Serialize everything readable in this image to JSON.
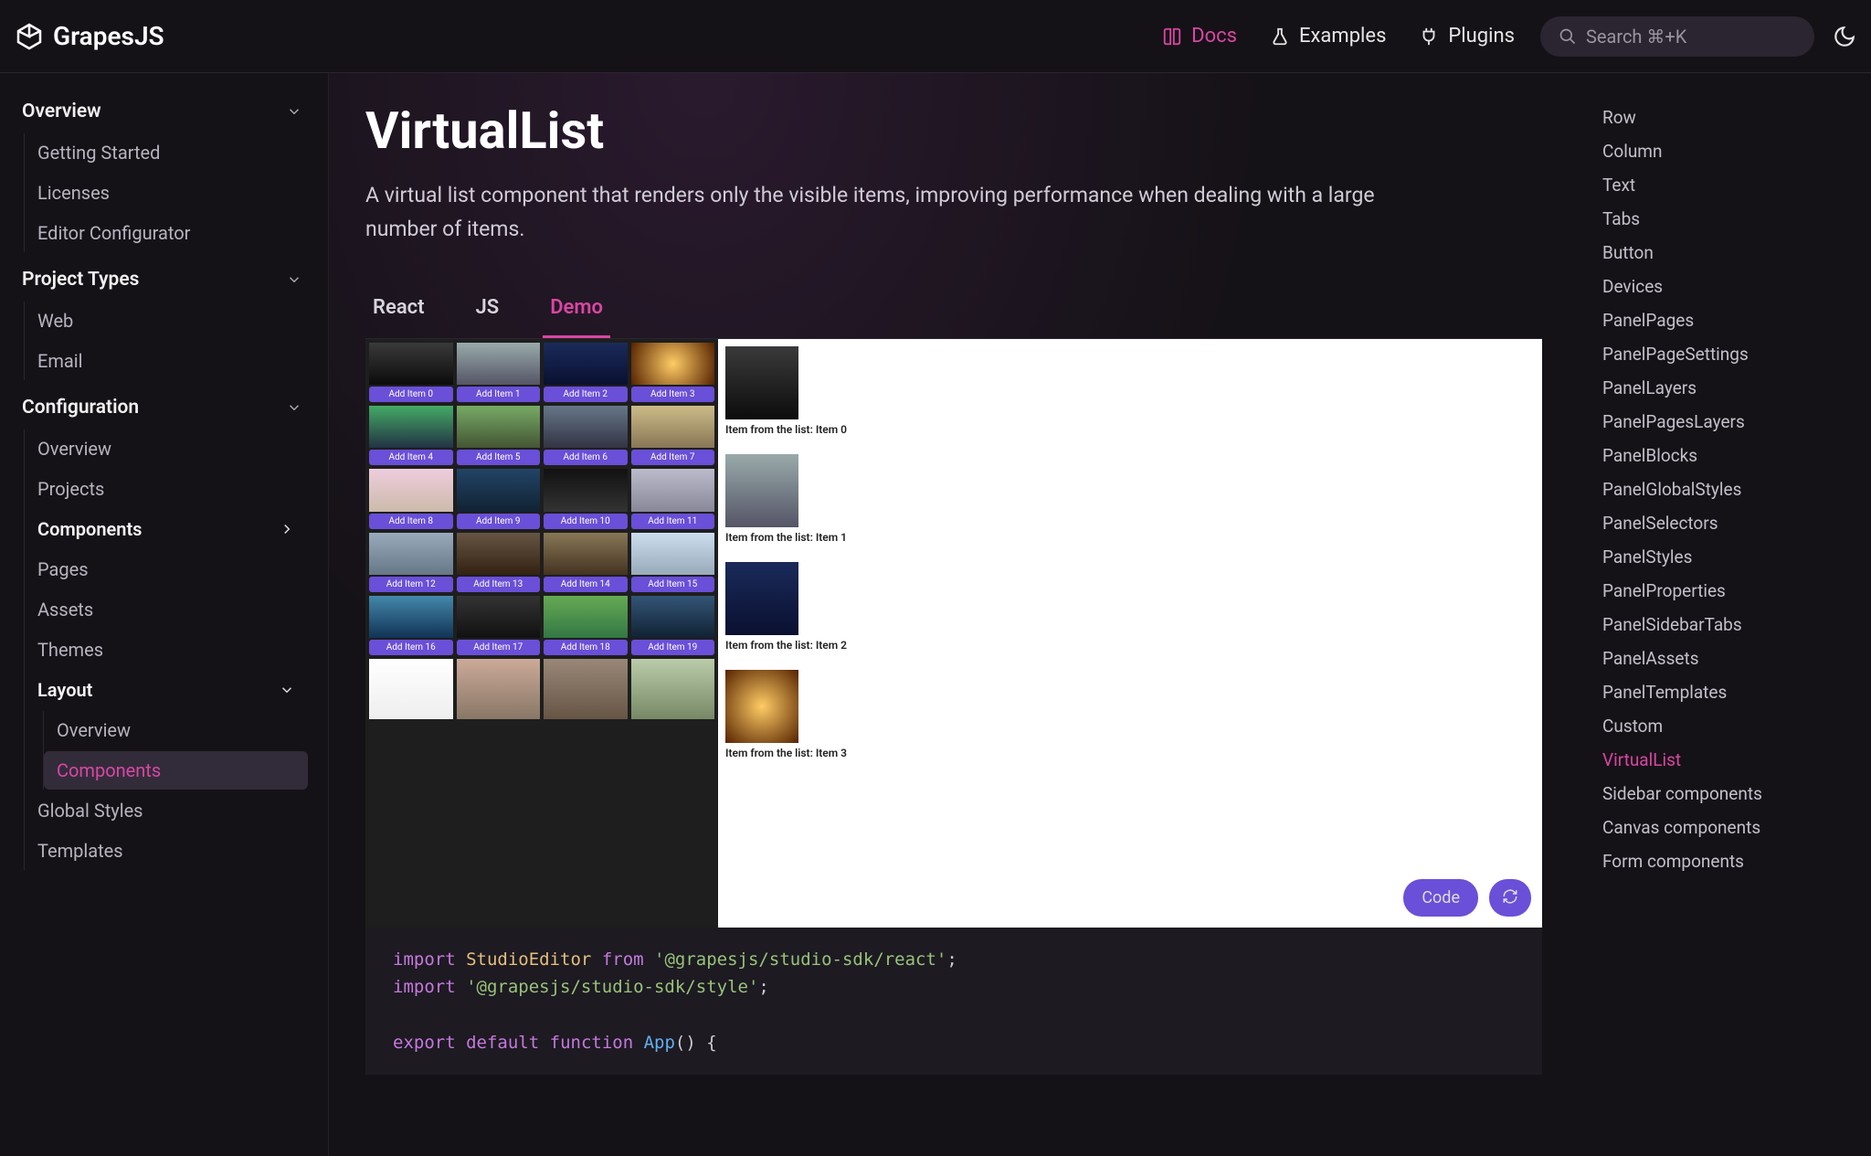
{
  "header": {
    "brand": "GrapesJS",
    "nav": {
      "docs": "Docs",
      "examples": "Examples",
      "plugins": "Plugins"
    },
    "search_placeholder": "Search ⌘+K"
  },
  "sidebar": {
    "sections": [
      {
        "title": "Overview",
        "items": [
          "Getting Started",
          "Licenses",
          "Editor Configurator"
        ]
      },
      {
        "title": "Project Types",
        "items": [
          "Web",
          "Email"
        ]
      },
      {
        "title": "Configuration",
        "items": [
          "Overview",
          "Projects",
          "Components",
          "Pages",
          "Assets",
          "Themes",
          "Layout",
          "Global Styles",
          "Templates"
        ],
        "components_sub": [],
        "layout_sub": [
          "Overview",
          "Components"
        ]
      }
    ]
  },
  "page": {
    "title": "VirtualList",
    "description": "A virtual list component that renders only the visible items, improving performance when dealing with a large number of items.",
    "tabs": {
      "react": "React",
      "js": "JS",
      "demo": "Demo"
    }
  },
  "demo": {
    "add_prefix": "Add Item",
    "list_prefix": "Item from the list: Item",
    "grid_count": 20,
    "visible_list_items": [
      0,
      1,
      2,
      3
    ],
    "code_btn": "Code"
  },
  "code": {
    "l1a": "import",
    "l1b": "StudioEditor",
    "l1c": "from",
    "l1d": "'@grapesjs/studio-sdk/react'",
    "l1e": ";",
    "l2a": "import",
    "l2b": "'@grapesjs/studio-sdk/style'",
    "l2c": ";",
    "l3a": "export",
    "l3b": "default",
    "l3c": "function",
    "l3d": "App",
    "l3e": "() {"
  },
  "toc": [
    "Row",
    "Column",
    "Text",
    "Tabs",
    "Button",
    "Devices",
    "PanelPages",
    "PanelPageSettings",
    "PanelLayers",
    "PanelPagesLayers",
    "PanelBlocks",
    "PanelGlobalStyles",
    "PanelSelectors",
    "PanelStyles",
    "PanelProperties",
    "PanelSidebarTabs",
    "PanelAssets",
    "PanelTemplates",
    "Custom",
    "VirtualList",
    "Sidebar components",
    "Canvas components",
    "Form components"
  ],
  "toc_active": "VirtualList"
}
